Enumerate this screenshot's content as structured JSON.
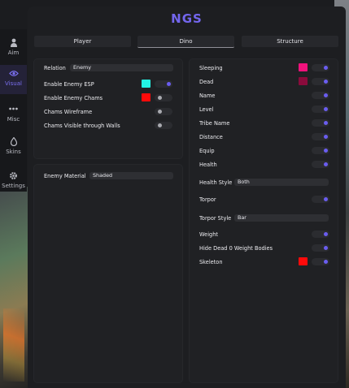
{
  "app": {
    "logo": "NGS"
  },
  "colors": {
    "accent": "#6a5df0",
    "cyan": "#23f2e3",
    "red": "#ff0a0a",
    "pink": "#f0127c",
    "maroon": "#8a0b3c"
  },
  "sidebar": {
    "items": [
      {
        "label": "Aim",
        "icon": "person-icon",
        "active": false
      },
      {
        "label": "Visual",
        "icon": "eye-icon",
        "active": true
      },
      {
        "label": "Misc",
        "icon": "dots-icon",
        "active": false
      },
      {
        "label": "Skins",
        "icon": "drop-icon",
        "active": false
      },
      {
        "label": "Settings",
        "icon": "gear-icon",
        "active": false
      }
    ]
  },
  "tabs": [
    {
      "label": "Player",
      "active": false
    },
    {
      "label": "Dino",
      "active": true
    },
    {
      "label": "Structure",
      "active": false
    }
  ],
  "left_panel": {
    "relation_label": "Relation",
    "relation_value": "Enemy",
    "enable_esp_label": "Enable Enemy ESP",
    "enable_esp_on": true,
    "enable_chams_label": "Enable Enemy Chams",
    "enable_chams_on": false,
    "chams_wireframe_label": "Chams Wireframe",
    "chams_wireframe_on": false,
    "chams_visible_label": "Chams Visible through Walls",
    "chams_visible_on": false
  },
  "material_panel": {
    "label": "Enemy Material",
    "value": "Shaded"
  },
  "right_panel": {
    "sleeping_label": "Sleeping",
    "dead_label": "Dead",
    "name_label": "Name",
    "level_label": "Level",
    "tribe_label": "Tribe Name",
    "distance_label": "Distance",
    "equip_label": "Equip",
    "health_label": "Health",
    "health_style_label": "Health Style",
    "health_style_value": "Both",
    "torpor_label": "Torpor",
    "torpor_style_label": "Torpor Style",
    "torpor_style_value": "Bar",
    "weight_label": "Weight",
    "hide_dead_label": "Hide Dead 0 Weight Bodies",
    "skeleton_label": "Skeleton"
  }
}
